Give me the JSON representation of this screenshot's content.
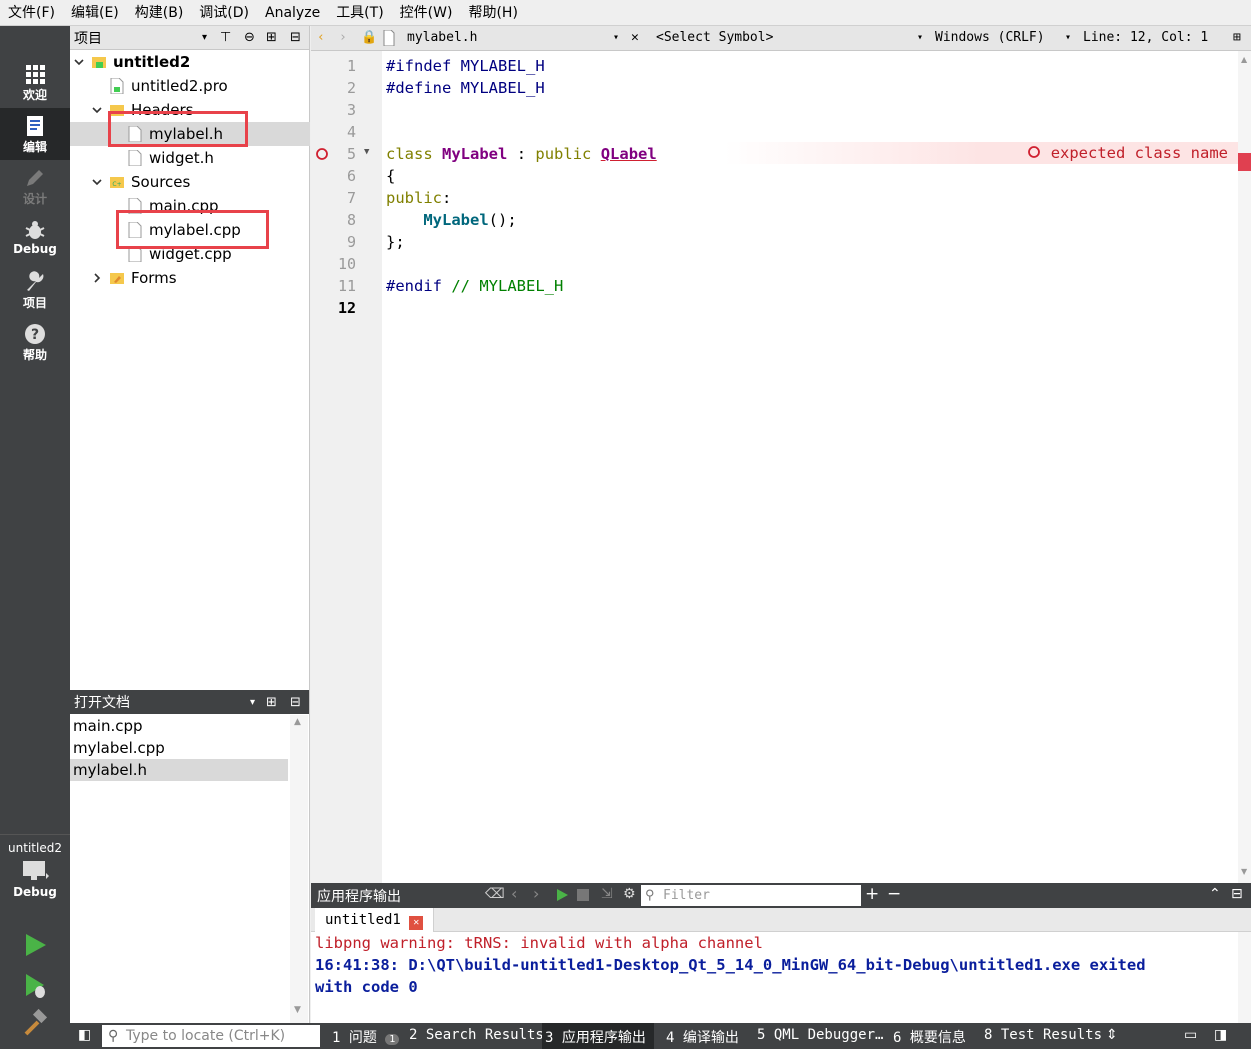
{
  "menu": [
    "文件(F)",
    "编辑(E)",
    "构建(B)",
    "调试(D)",
    "Analyze",
    "工具(T)",
    "控件(W)",
    "帮助(H)"
  ],
  "modes": {
    "welcome": "欢迎",
    "edit": "编辑",
    "design": "设计",
    "debug": "Debug",
    "projects": "项目",
    "help": "帮助"
  },
  "kit": {
    "project": "untitled2",
    "build": "Debug"
  },
  "project_pane": {
    "title": "项目",
    "root": "untitled2",
    "pro_file": "untitled2.pro",
    "headers": "Headers",
    "header_files": [
      "mylabel.h",
      "widget.h"
    ],
    "sources": "Sources",
    "source_files": [
      "main.cpp",
      "mylabel.cpp",
      "widget.cpp"
    ],
    "forms": "Forms"
  },
  "open_docs": {
    "title": "打开文档",
    "items": [
      "main.cpp",
      "mylabel.cpp",
      "mylabel.h"
    ]
  },
  "editor_toolbar": {
    "file": "mylabel.h",
    "symbol": "<Select Symbol>",
    "line_ending": "Windows (CRLF)",
    "position": "Line: 12, Col: 1"
  },
  "code": {
    "line_numbers": [
      "1",
      "2",
      "3",
      "4",
      "5",
      "6",
      "7",
      "8",
      "9",
      "10",
      "11",
      "12"
    ],
    "l1_dir": "#ifndef",
    "l1_mac": "MYLABEL_H",
    "l2_dir": "#define",
    "l2_mac": "MYLABEL_H",
    "l5_kw": "class",
    "l5_cls": "MyLabel",
    "l5_colon": ":",
    "l5_pub": "public",
    "l5_base": "QLabel",
    "l6": "{",
    "l7_kw": "public",
    "l7_colon": ":",
    "l8_fn": "MyLabel",
    "l8_rest": "();",
    "l9": "};",
    "l11_dir": "#endif",
    "l11_cm": "// MYLABEL_H",
    "error": "expected class name"
  },
  "output": {
    "title": "应用程序输出",
    "filter_placeholder": "Filter",
    "tab": "untitled1",
    "line1": "libpng warning: tRNS: invalid with alpha channel",
    "line2": "16:41:38: D:\\QT\\build-untitled1-Desktop_Qt_5_14_0_MinGW_64_bit-Debug\\untitled1.exe exited",
    "line3": "with code 0"
  },
  "statusbar": {
    "locate_placeholder": "Type to locate (Ctrl+K)",
    "tabs": [
      "1 问题",
      "2 Search Results",
      "3 应用程序输出",
      "4 编译输出",
      "5 QML Debugger…",
      "6 概要信息",
      "8 Test Results"
    ],
    "issues_count": "1"
  },
  "colors": {
    "error": "#c0202a",
    "annotation_box": "#e8424a",
    "sidebar": "#404244"
  }
}
